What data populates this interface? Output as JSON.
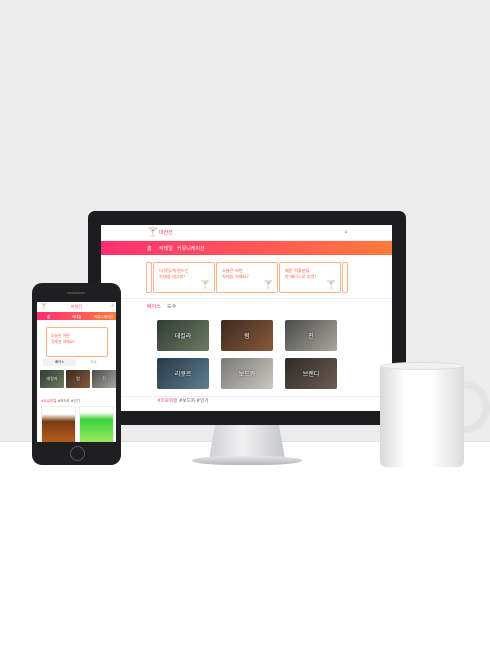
{
  "colors": {
    "accent_pink": "#ff3d6e",
    "accent_orange": "#ff7a3d",
    "card_border": "#ffb38a"
  },
  "desktop": {
    "logo_icon": "cocktail-glass-icon",
    "logo_text": "마한잔",
    "search_icon": "search-icon",
    "nav": [
      "홈",
      "칵테일",
      "커뮤니케이션"
    ],
    "cards": [
      {
        "line1": "더 맛있게 만드는",
        "line2": "칵테일 레시피!"
      },
      {
        "line1": "오늘은 어떤",
        "line2": "칵테일 어때요?"
      },
      {
        "line1": "매운 먹을분들",
        "line2": "한 페이스로 추천!"
      }
    ],
    "tabs": [
      "베이스",
      "도수"
    ],
    "tiles": [
      "데킬라",
      "럼",
      "진",
      "리큐르",
      "보드카",
      "브랜디"
    ],
    "tags_hot": "#트로피컬",
    "tags_rest": "#보드카 #인기"
  },
  "mobile": {
    "logo_text": "마한잔",
    "nav": [
      "홈",
      "칵테일",
      "커뮤니케이션"
    ],
    "card": {
      "line1": "오늘은 어떤",
      "line2": "칵테일 어때요?"
    },
    "tabs": [
      "베이스",
      "도수"
    ],
    "tiles": [
      "데킬라",
      "럼",
      "진"
    ],
    "tags_hot": "#트로피컬",
    "tags_rest": "#보드카 #인기"
  }
}
